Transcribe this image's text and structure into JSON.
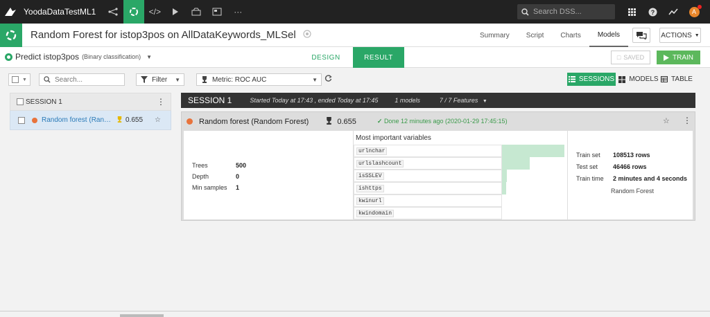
{
  "topnav": {
    "project_name": "YoodaDataTestML1",
    "search_placeholder": "Search DSS...",
    "avatar_letter": "A"
  },
  "titlebar": {
    "title": "Random Forest for istop3pos on AllDataKeywords_MLSel",
    "tabs": [
      "Summary",
      "Script",
      "Charts",
      "Models"
    ],
    "active_tab": "Models",
    "actions_label": "ACTIONS"
  },
  "subbar": {
    "predict_label": "Predict istop3pos",
    "predict_type": "(Binary classification)",
    "design_label": "DESIGN",
    "result_label": "RESULT",
    "saved_label": "SAVED",
    "train_label": "TRAIN"
  },
  "toolbar": {
    "search_placeholder": "Search...",
    "filter_label": "Filter",
    "metric_label": "Metric: ROC AUC",
    "sessions_label": "SESSIONS",
    "models_label": "MODELS",
    "table_label": "TABLE"
  },
  "left_panel": {
    "session_label": "SESSION 1",
    "model_name": "Random forest (Random Forest)",
    "model_score": "0.655"
  },
  "session": {
    "name": "SESSION 1",
    "timing": "Started Today at 17:43 , ended Today at 17:45",
    "models_count": "1 models",
    "features": "7 / 7 Features"
  },
  "model": {
    "name": "Random forest (Random Forest)",
    "score": "0.655",
    "status": "Done 12 minutes ago (2020-01-29 17:45:15)",
    "params": [
      {
        "label": "Trees",
        "value": "500"
      },
      {
        "label": "Depth",
        "value": "0"
      },
      {
        "label": "Min samples",
        "value": "1"
      }
    ],
    "variables_title": "Most important variables",
    "variables": [
      {
        "name": "urlnchar",
        "importance": 1.0
      },
      {
        "name": "urlslashcount",
        "importance": 0.44
      },
      {
        "name": "isSSLEV",
        "importance": 0.08
      },
      {
        "name": "ishttps",
        "importance": 0.07
      },
      {
        "name": "kwinurl",
        "importance": 0.0
      },
      {
        "name": "kwindomain",
        "importance": 0.0
      }
    ],
    "train": [
      {
        "label": "Train set",
        "value": "108513 rows"
      },
      {
        "label": "Test set",
        "value": "46466 rows"
      },
      {
        "label": "Train time",
        "value": "2 minutes and 4 seconds"
      }
    ],
    "algorithm": "Random Forest"
  },
  "colors": {
    "accent_green": "#2aa767",
    "model_dot": "#e8733c",
    "importance_bar": "#c6e8d1"
  }
}
